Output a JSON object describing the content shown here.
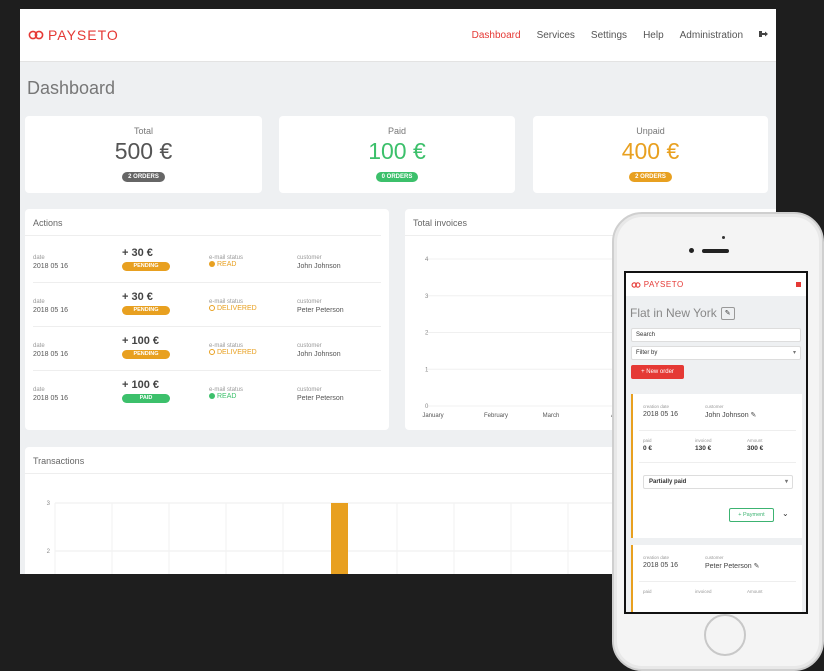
{
  "brand": {
    "name": "PAYSETO",
    "color": "#e53935"
  },
  "nav": {
    "items": [
      "Dashboard",
      "Services",
      "Settings",
      "Help",
      "Administration"
    ],
    "active": "Dashboard",
    "logout_icon": "sign-out-icon"
  },
  "page_title": "Dashboard",
  "stats": [
    {
      "label": "Total",
      "value": "500 €",
      "badge": "2 ORDERS",
      "color": "#555555",
      "badge_color": "#666666"
    },
    {
      "label": "Paid",
      "value": "100 €",
      "badge": "0 ORDERS",
      "color": "#3cc06b",
      "badge_color": "#3cc06b"
    },
    {
      "label": "Unpaid",
      "value": "400 €",
      "badge": "2 ORDERS",
      "color": "#e8a020",
      "badge_color": "#e8a020"
    }
  ],
  "actions": {
    "title": "Actions",
    "rows": [
      {
        "date_label": "date",
        "date": "2018 05 16",
        "amount": "+ 30 €",
        "status": "PENDING",
        "email_label": "e-mail status",
        "email_status": "READ",
        "customer_label": "customer",
        "customer": "John Johnson"
      },
      {
        "date_label": "date",
        "date": "2018 05 16",
        "amount": "+ 30 €",
        "status": "PENDING",
        "email_label": "e-mail status",
        "email_status": "DELIVERED",
        "customer_label": "customer",
        "customer": "Peter Peterson"
      },
      {
        "date_label": "date",
        "date": "2018 05 16",
        "amount": "+ 100 €",
        "status": "PENDING",
        "email_label": "e-mail status",
        "email_status": "DELIVERED",
        "customer_label": "customer",
        "customer": "John Johnson"
      },
      {
        "date_label": "date",
        "date": "2018 05 16",
        "amount": "+ 100 €",
        "status": "PAID",
        "email_label": "e-mail status",
        "email_status": "READ",
        "customer_label": "customer",
        "customer": "Peter Peterson"
      }
    ]
  },
  "colors": {
    "pending": "#e8a020",
    "paid": "#3cc06b",
    "read_pending": "#e8a020",
    "read_paid": "#3cc06b"
  },
  "chart_data": [
    {
      "type": "bar",
      "title": "Total invoices",
      "categories": [
        "January",
        "February",
        "March",
        "A"
      ],
      "ylim": [
        0,
        4
      ],
      "yticks": [
        "0",
        "1",
        "2",
        "3",
        "4"
      ],
      "grid": true
    },
    {
      "type": "bar",
      "title": "Transactions",
      "yticks": [
        "2",
        "3"
      ],
      "series": [
        {
          "values": [
            null,
            null,
            null,
            null,
            null,
            3.0,
            null,
            null,
            null,
            null,
            null
          ]
        }
      ],
      "bar_color": "#e8a020",
      "grid": true
    }
  ],
  "mobile": {
    "brand": "PAYSETO",
    "title": "Flat in New York",
    "edit_icon": "pencil-icon",
    "search_placeholder": "Search",
    "filter": "Filter by",
    "new_order": "+ New order",
    "orders": [
      {
        "creation_label": "creation date",
        "creation": "2018 05 16",
        "customer_label": "customer",
        "customer": "John Johnson",
        "paid_label": "paid",
        "paid": "0 €",
        "invoiced_label": "invoiced",
        "invoiced": "130 €",
        "amount_label": "Amount",
        "amount": "300 €",
        "status": "Partially paid",
        "payment_button": "+ Payment"
      },
      {
        "creation_label": "creation date",
        "creation": "2018 05 16",
        "customer_label": "customer",
        "customer": "Peter Peterson",
        "paid_label": "paid",
        "invoiced_label": "invoiced",
        "amount_label": "Amount"
      }
    ]
  }
}
